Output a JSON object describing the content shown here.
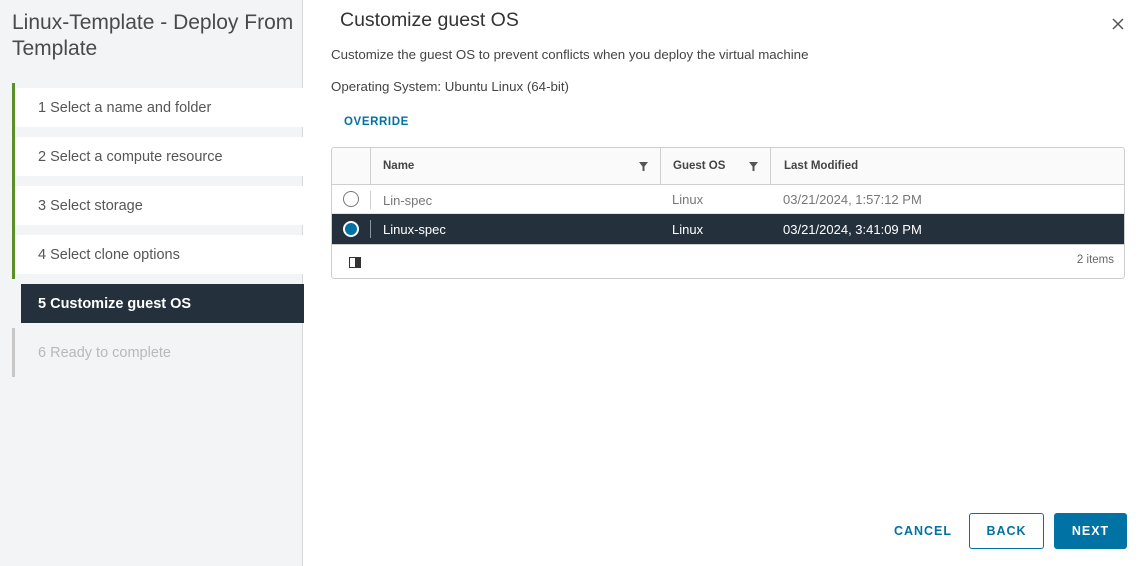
{
  "sidebar": {
    "title": "Linux-Template - Deploy From Template",
    "steps": [
      {
        "label": "1  Select a name and folder",
        "state": "done"
      },
      {
        "label": "2  Select a compute resource",
        "state": "done"
      },
      {
        "label": "3  Select storage",
        "state": "done"
      },
      {
        "label": "4  Select clone options",
        "state": "done"
      },
      {
        "label": "5  Customize guest OS",
        "state": "active"
      },
      {
        "label": "6  Ready to complete",
        "state": "disabled"
      }
    ]
  },
  "main": {
    "title": "Customize guest OS",
    "close_icon": "close-icon",
    "description": "Customize the guest OS to prevent conflicts when you deploy the virtual machine",
    "os_label": "Operating System: Ubuntu Linux (64-bit)",
    "override_label": "OVERRIDE"
  },
  "grid": {
    "columns": [
      "Name",
      "Guest OS",
      "Last Modified"
    ],
    "rows": [
      {
        "name": "Lin-spec",
        "guest_os": "Linux",
        "last_modified": "03/21/2024, 1:57:12 PM",
        "selected": false
      },
      {
        "name": "Linux-spec",
        "guest_os": "Linux",
        "last_modified": "03/21/2024, 3:41:09 PM",
        "selected": true
      }
    ],
    "footer_count": "2 items"
  },
  "buttons": {
    "cancel": "CANCEL",
    "back": "BACK",
    "next": "NEXT"
  },
  "colors": {
    "accent": "#0072a3",
    "selected_row": "#24313d",
    "step_done_bar": "#5a8f29"
  }
}
